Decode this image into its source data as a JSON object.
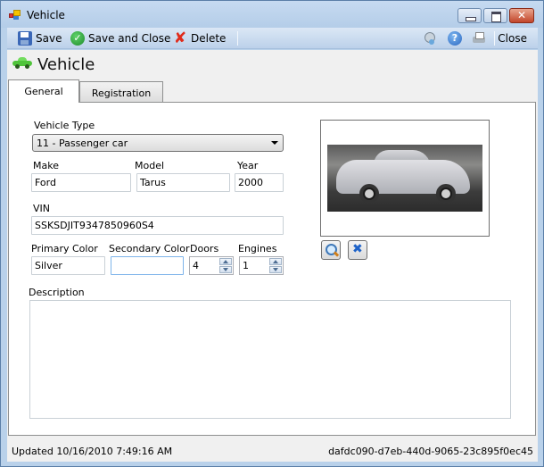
{
  "window": {
    "title": "Vehicle",
    "icon": "app-icon",
    "controls": [
      "minimize",
      "maximize",
      "close"
    ]
  },
  "toolbar": {
    "save_label": "Save",
    "save_and_close_label": "Save and Close",
    "delete_label": "Delete",
    "close_label": "Close",
    "icons": [
      "save-icon",
      "check-icon",
      "delete-icon",
      "user-settings-icon",
      "help-icon",
      "print-icon"
    ]
  },
  "header": {
    "title": "Vehicle",
    "icon": "car-icon"
  },
  "tabs": [
    {
      "label": "General",
      "active": true
    },
    {
      "label": "Registration",
      "active": false
    }
  ],
  "form": {
    "vehicle_type": {
      "label": "Vehicle Type",
      "value": "11 - Passenger car"
    },
    "make": {
      "label": "Make",
      "value": "Ford"
    },
    "model": {
      "label": "Model",
      "value": "Tarus"
    },
    "year": {
      "label": "Year",
      "value": "2000"
    },
    "vin": {
      "label": "VIN",
      "value": "SSKSDJIT9347850960S4"
    },
    "primary_color": {
      "label": "Primary Color",
      "value": "Silver"
    },
    "secondary_color": {
      "label": "Secondary Color",
      "value": ""
    },
    "doors": {
      "label": "Doors",
      "value": "4"
    },
    "engines": {
      "label": "Engines",
      "value": "1"
    },
    "description": {
      "label": "Description",
      "value": ""
    }
  },
  "image": {
    "alt": "Silver sedan vehicle photo",
    "buttons": [
      "zoom-image",
      "clear-image"
    ]
  },
  "status": {
    "updated": "Updated 10/16/2010 7:49:16 AM",
    "id": "dafdc090-d7eb-440d-9065-23c895f0ec45"
  }
}
